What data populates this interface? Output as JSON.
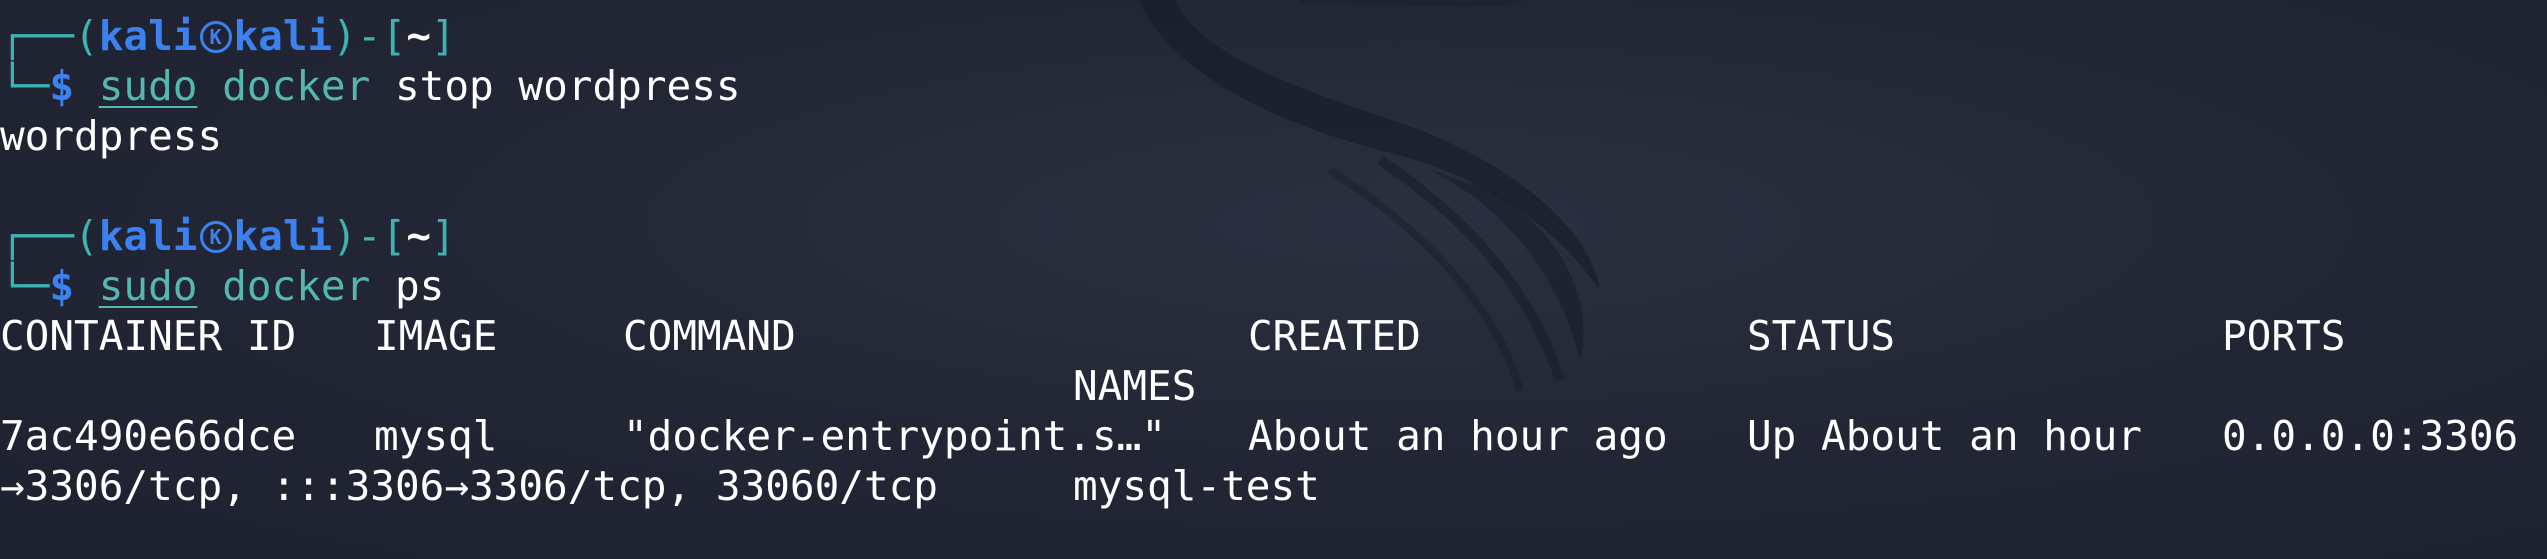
{
  "prompt": {
    "user": "kali",
    "host": "kali",
    "dir": "~",
    "open_paren": "┌──(",
    "close_bracket": ")-[",
    "end_bracket": "]",
    "prompt_line_prefix": "└─",
    "dollar": "$"
  },
  "block1": {
    "cmd_sudo": "sudo",
    "cmd_docker": "docker",
    "cmd_args": "stop wordpress",
    "output": "wordpress"
  },
  "block2": {
    "cmd_sudo": "sudo",
    "cmd_docker": "docker",
    "cmd_args": "ps"
  },
  "ps_table": {
    "headers": {
      "container_id": "CONTAINER ID",
      "image": "IMAGE",
      "command": "COMMAND",
      "created": "CREATED",
      "status": "STATUS",
      "ports": "PORTS",
      "names": "NAMES"
    },
    "rows": [
      {
        "container_id": "7ac490e66dce",
        "image": "mysql",
        "command": "\"docker-entrypoint.s…\"",
        "created": "About an hour ago",
        "status": "Up About an hour",
        "ports_part1": "0.0.0.0:3306",
        "ports_part2": "→3306/tcp, :::3306→3306/tcp, 33060/tcp",
        "names": "mysql-test"
      }
    ]
  },
  "colors": {
    "background": "#232735",
    "prompt_bracket": "#3bb4b4",
    "user_host": "#3b82f0",
    "command": "#54b8b0",
    "text": "#ffffff"
  }
}
